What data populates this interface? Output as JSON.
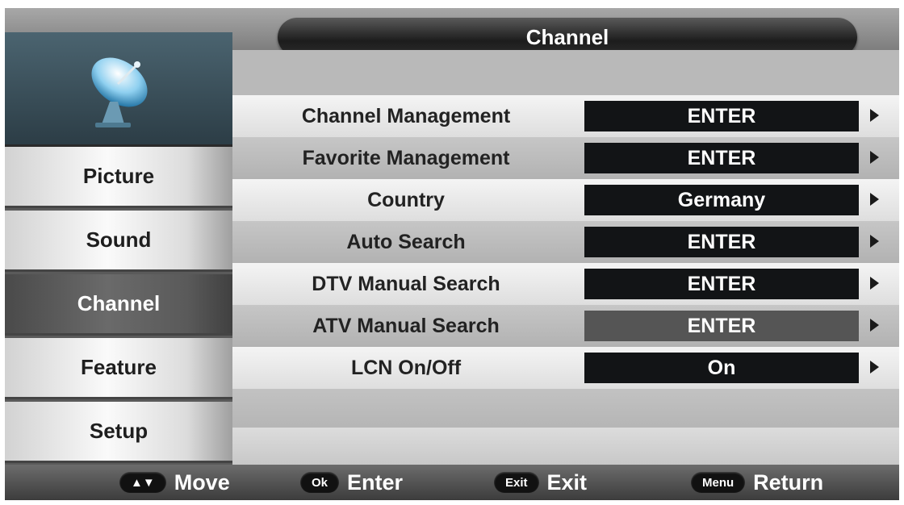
{
  "title": "Channel",
  "sidebar": {
    "icon": "satellite-dish-icon",
    "items": [
      {
        "label": "Picture",
        "active": false
      },
      {
        "label": "Sound",
        "active": false
      },
      {
        "label": "Channel",
        "active": true
      },
      {
        "label": "Feature",
        "active": false
      },
      {
        "label": "Setup",
        "active": false
      }
    ]
  },
  "rows": [
    {
      "label": "Channel Management",
      "value": "ENTER"
    },
    {
      "label": "Favorite Management",
      "value": "ENTER"
    },
    {
      "label": "Country",
      "value": "Germany"
    },
    {
      "label": "Auto Search",
      "value": "ENTER"
    },
    {
      "label": "DTV Manual Search",
      "value": "ENTER"
    },
    {
      "label": "ATV Manual Search",
      "value": "ENTER",
      "highlighted": true
    },
    {
      "label": "LCN On/Off",
      "value": "On"
    }
  ],
  "footer": [
    {
      "key": "▲▼",
      "label": "Move"
    },
    {
      "key": "Ok",
      "label": "Enter"
    },
    {
      "key": "Exit",
      "label": "Exit"
    },
    {
      "key": "Menu",
      "label": "Return"
    }
  ],
  "colors": {
    "value_box": "#121416",
    "active_sidebar": "#5a5a5a",
    "title_bar": "#1c1c1c"
  }
}
